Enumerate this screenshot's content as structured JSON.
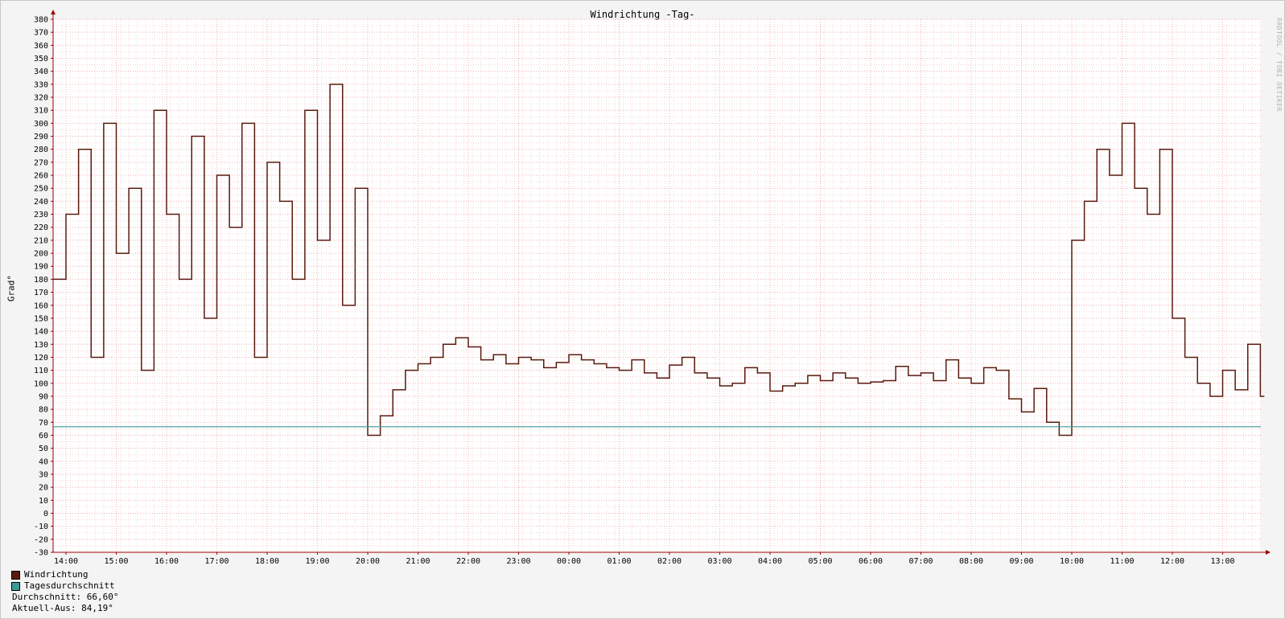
{
  "chart_data": {
    "type": "line",
    "title": "Windrichtung -Tag-",
    "ylabel": "Grad°",
    "xlabel": "",
    "ylim": [
      -30,
      380
    ],
    "yticks": [
      -30,
      -20,
      -10,
      0,
      10,
      20,
      30,
      40,
      50,
      60,
      70,
      80,
      90,
      100,
      110,
      120,
      130,
      140,
      150,
      160,
      170,
      180,
      190,
      200,
      210,
      220,
      230,
      240,
      250,
      260,
      270,
      280,
      290,
      300,
      310,
      320,
      330,
      340,
      350,
      360,
      370,
      380
    ],
    "xlim_hours": [
      "13:45",
      "13:50 (next day)"
    ],
    "x_tick_labels": [
      "14:00",
      "15:00",
      "16:00",
      "17:00",
      "18:00",
      "19:00",
      "20:00",
      "21:00",
      "22:00",
      "23:00",
      "00:00",
      "01:00",
      "02:00",
      "03:00",
      "04:00",
      "05:00",
      "06:00",
      "07:00",
      "08:00",
      "09:00",
      "10:00",
      "11:00",
      "12:00",
      "13:00"
    ],
    "grid": true,
    "series": [
      {
        "name": "Windrichtung",
        "color": "#5a1a0e",
        "x_time": [
          "13:45",
          "14:00",
          "14:15",
          "14:30",
          "14:45",
          "15:00",
          "15:15",
          "15:30",
          "15:45",
          "16:00",
          "16:15",
          "16:30",
          "16:45",
          "17:00",
          "17:15",
          "17:30",
          "17:45",
          "18:00",
          "18:15",
          "18:30",
          "18:45",
          "19:00",
          "19:15",
          "19:30",
          "19:45",
          "20:00",
          "20:15",
          "20:30",
          "20:45",
          "21:00",
          "21:15",
          "21:30",
          "21:45",
          "22:00",
          "22:15",
          "22:30",
          "22:45",
          "23:00",
          "23:15",
          "23:30",
          "23:45",
          "00:00",
          "00:15",
          "00:30",
          "00:45",
          "01:00",
          "01:15",
          "01:30",
          "01:45",
          "02:00",
          "02:15",
          "02:30",
          "02:45",
          "03:00",
          "03:15",
          "03:30",
          "03:45",
          "04:00",
          "04:15",
          "04:30",
          "04:45",
          "05:00",
          "05:15",
          "05:30",
          "05:45",
          "06:00",
          "06:15",
          "06:30",
          "06:45",
          "07:00",
          "07:15",
          "07:30",
          "07:45",
          "08:00",
          "08:15",
          "08:30",
          "08:45",
          "09:00",
          "09:15",
          "09:30",
          "09:45",
          "10:00",
          "10:15",
          "10:30",
          "10:45",
          "11:00",
          "11:15",
          "11:30",
          "11:45",
          "12:00",
          "12:15",
          "12:30",
          "12:45",
          "13:00",
          "13:15",
          "13:30",
          "13:45"
        ],
        "values": [
          180,
          230,
          280,
          120,
          300,
          200,
          250,
          110,
          310,
          230,
          180,
          290,
          150,
          260,
          220,
          300,
          120,
          270,
          240,
          180,
          310,
          210,
          330,
          160,
          250,
          60,
          75,
          95,
          110,
          115,
          120,
          130,
          135,
          128,
          118,
          122,
          115,
          120,
          118,
          112,
          116,
          122,
          118,
          115,
          112,
          110,
          118,
          108,
          104,
          114,
          120,
          108,
          104,
          98,
          100,
          112,
          108,
          94,
          98,
          100,
          106,
          102,
          108,
          104,
          100,
          101,
          102,
          113,
          106,
          108,
          102,
          118,
          104,
          100,
          112,
          110,
          88,
          78,
          96,
          70,
          60,
          210,
          240,
          280,
          260,
          300,
          250,
          230,
          280,
          150,
          120,
          100,
          90,
          110,
          95,
          130,
          90
        ]
      },
      {
        "name": "Tagesdurchschnitt",
        "color": "#3a9a94",
        "values": [
          66.6
        ]
      }
    ],
    "stats": {
      "average_label": "Durchschnitt: 66,60°",
      "current_label": "Aktuell-Aus: 84,19°"
    },
    "watermark": "RRDTOOL / TOBI OETIKER"
  }
}
